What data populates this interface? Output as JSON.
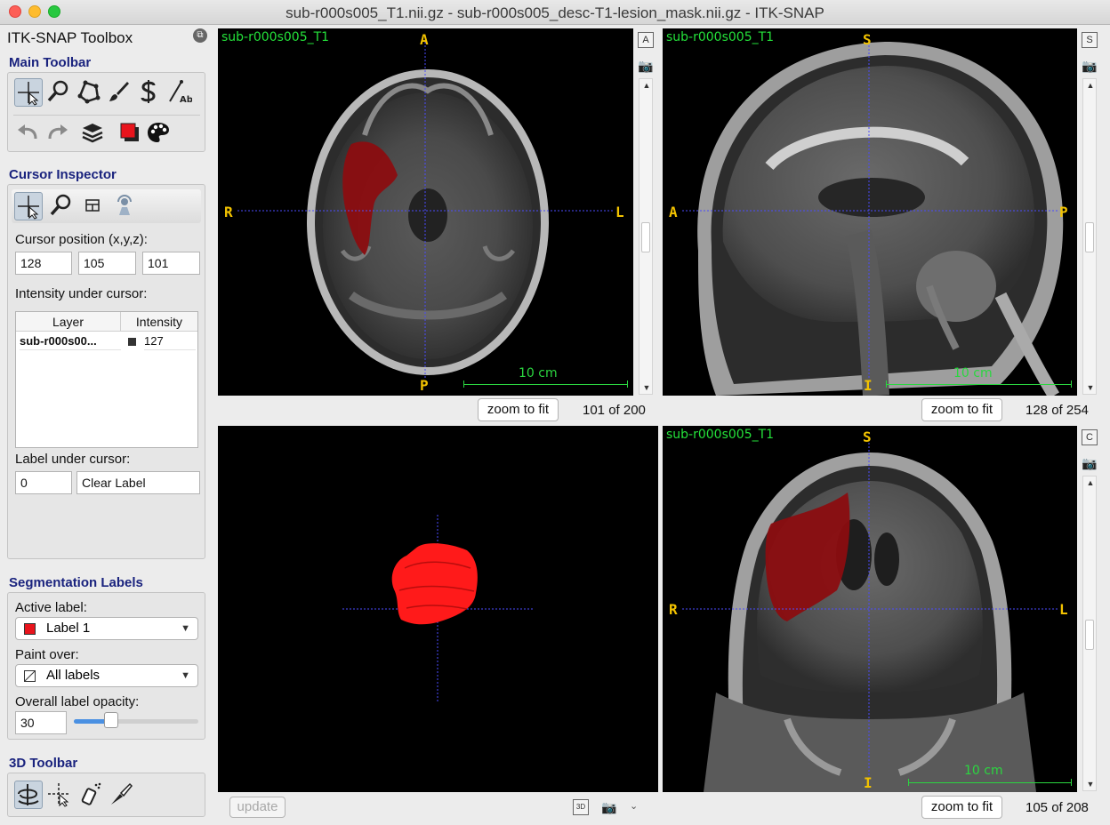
{
  "window": {
    "title": "sub-r000s005_T1.nii.gz - sub-r000s005_desc-T1-lesion_mask.nii.gz - ITK-SNAP"
  },
  "toolbox": {
    "title": "ITK-SNAP Toolbox",
    "main_toolbar": {
      "title": "Main Toolbar",
      "tools": [
        "crosshair-tool-icon",
        "zoom-tool-icon",
        "polygon-tool-icon",
        "paintbrush-tool-icon",
        "snake-tool-icon",
        "annotation-tool-icon"
      ],
      "actions": [
        "undo-icon",
        "redo-icon",
        "layers-icon",
        "label-color-icon",
        "palette-icon"
      ]
    },
    "cursor_inspector": {
      "title": "Cursor Inspector",
      "cursor_position_label": "Cursor position (x,y,z):",
      "x": "128",
      "y": "105",
      "z": "101",
      "intensity_label": "Intensity under cursor:",
      "table": {
        "headers": [
          "Layer",
          "Intensity"
        ],
        "rows": [
          {
            "layer": "sub-r000s00...",
            "intensity": "127"
          }
        ]
      },
      "label_under_cursor_label": "Label under cursor:",
      "label_value": "0",
      "label_name": "Clear Label"
    },
    "segmentation_labels": {
      "title": "Segmentation Labels",
      "active_label_label": "Active label:",
      "active_label": "Label 1",
      "active_label_color": "#e8141c",
      "paint_over_label": "Paint over:",
      "paint_over": "All labels",
      "opacity_label": "Overall label opacity:",
      "opacity_value": "30",
      "opacity_fraction": 0.3
    },
    "toolbar_3d": {
      "title": "3D Toolbar",
      "tools": [
        "rotate-3d-icon",
        "crosshair-3d-icon",
        "spray-paint-icon",
        "scalpel-icon"
      ]
    }
  },
  "views": {
    "axial": {
      "layer_name": "sub-r000s005_T1",
      "ori_top": "A",
      "ori_bottom": "P",
      "ori_left": "R",
      "ori_right": "L",
      "scale": "10 cm",
      "side_letter": "A",
      "zoom_btn": "zoom to fit",
      "slice": "101 of 200"
    },
    "sagittal": {
      "layer_name": "sub-r000s005_T1",
      "ori_top": "S",
      "ori_bottom": "I",
      "ori_left": "A",
      "ori_right": "P",
      "scale": "10 cm",
      "side_letter": "S",
      "zoom_btn": "zoom to fit",
      "slice": "128 of 254"
    },
    "render3d": {
      "update_btn": "update",
      "btn_3d": "3D"
    },
    "coronal": {
      "layer_name": "sub-r000s005_T1",
      "ori_top": "S",
      "ori_bottom": "I",
      "ori_left": "R",
      "ori_right": "L",
      "scale": "10 cm",
      "side_letter": "C",
      "zoom_btn": "zoom to fit",
      "slice": "105 of 208"
    }
  },
  "colors": {
    "lesion": "#8b0d10",
    "lesion_3d": "#ff1a1a",
    "crosshair": "#4b4bff",
    "overlay_text": "#24e03a",
    "orientation": "#f2c200",
    "section_title": "#1a237e"
  }
}
